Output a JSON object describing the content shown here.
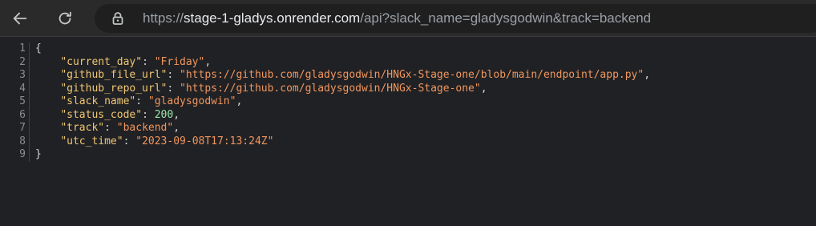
{
  "browser": {
    "url_scheme": "https://",
    "url_host": "stage-1-gladys.onrender.com",
    "url_rest": "/api?slack_name=gladysgodwin&track=backend"
  },
  "json_viewer": {
    "lines": [
      {
        "n": "1",
        "open": "{"
      },
      {
        "n": "2",
        "key": "\"current_day\"",
        "sep": ": ",
        "value": "\"Friday\"",
        "type": "str",
        "tail": ","
      },
      {
        "n": "3",
        "key": "\"github_file_url\"",
        "sep": ": ",
        "value": "\"https://github.com/gladysgodwin/HNGx-Stage-one/blob/main/endpoint/app.py\"",
        "type": "str",
        "tail": ","
      },
      {
        "n": "4",
        "key": "\"github_repo_url\"",
        "sep": ": ",
        "value": "\"https://github.com/gladysgodwin/HNGx-Stage-one\"",
        "type": "str",
        "tail": ","
      },
      {
        "n": "5",
        "key": "\"slack_name\"",
        "sep": ": ",
        "value": "\"gladysgodwin\"",
        "type": "str",
        "tail": ","
      },
      {
        "n": "6",
        "key": "\"status_code\"",
        "sep": ": ",
        "value": "200",
        "type": "num",
        "tail": ","
      },
      {
        "n": "7",
        "key": "\"track\"",
        "sep": ": ",
        "value": "\"backend\"",
        "type": "str",
        "tail": ","
      },
      {
        "n": "8",
        "key": "\"utc_time\"",
        "sep": ": ",
        "value": "\"2023-09-08T17:13:24Z\"",
        "type": "str",
        "tail": ""
      },
      {
        "n": "9",
        "close": "}"
      }
    ]
  },
  "colors": {
    "background": "#202124",
    "key": "#f0c674",
    "string": "#f0965e",
    "number": "#9ae6a6"
  }
}
